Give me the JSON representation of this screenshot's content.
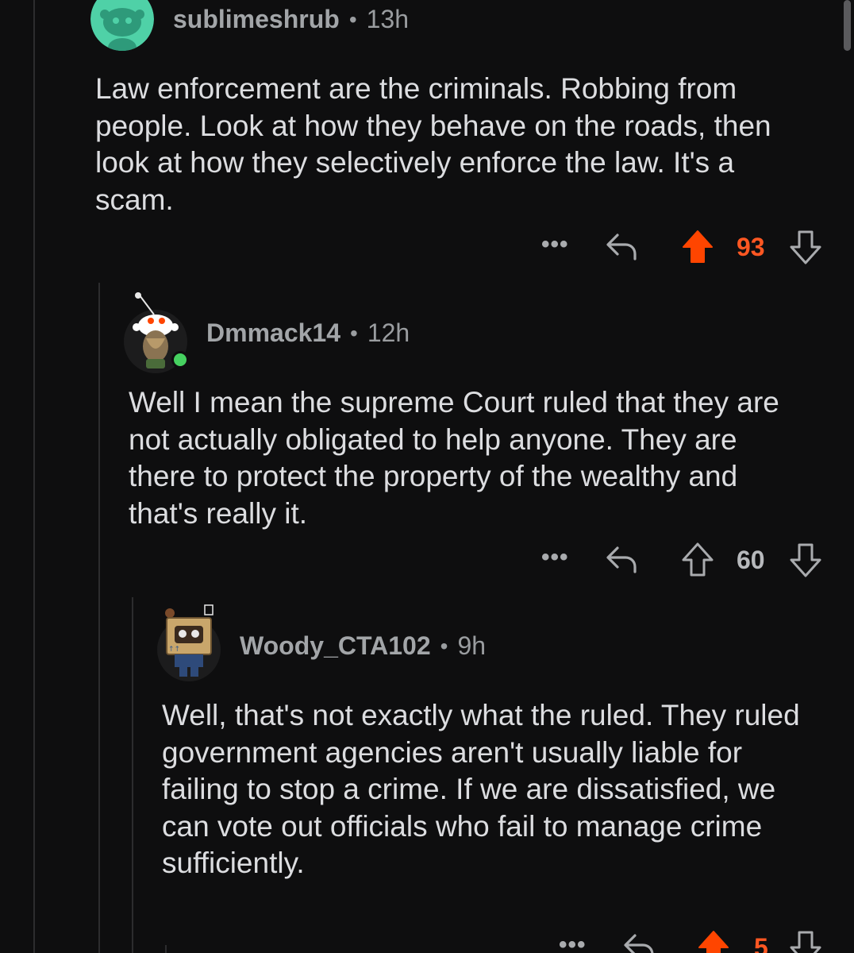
{
  "colors": {
    "background": "#0e0e0f",
    "upvote_active": "#ff4500",
    "score_active": "#ff5722",
    "muted": "#a9abae",
    "online_dot": "#46d160"
  },
  "comments": [
    {
      "username": "sublimeshrub",
      "time": "13h",
      "body": "Law enforcement are the criminals. Robbing from people. Look at how they behave on the roads, then look at how they selectively enforce the law. It's a scam.",
      "score": "93",
      "vote_state": "upvoted",
      "more_label": "•••"
    },
    {
      "username": "Dmmack14",
      "time": "12h",
      "body": "Well I mean the supreme Court ruled that they are not actually obligated to help anyone. They are there to protect the property of the wealthy and that's really it.",
      "score": "60",
      "vote_state": "none",
      "online": true,
      "more_label": "•••"
    },
    {
      "username": "Woody_CTA102",
      "time": "9h",
      "body": "Well, that's not exactly what the ruled. They ruled government agencies aren't usually liable for failing to stop a crime. If we are dissatisfied, we can vote out officials who fail to manage crime sufficiently.",
      "score": "5",
      "vote_state": "upvoted",
      "more_label": "•••"
    }
  ],
  "separator": "•"
}
